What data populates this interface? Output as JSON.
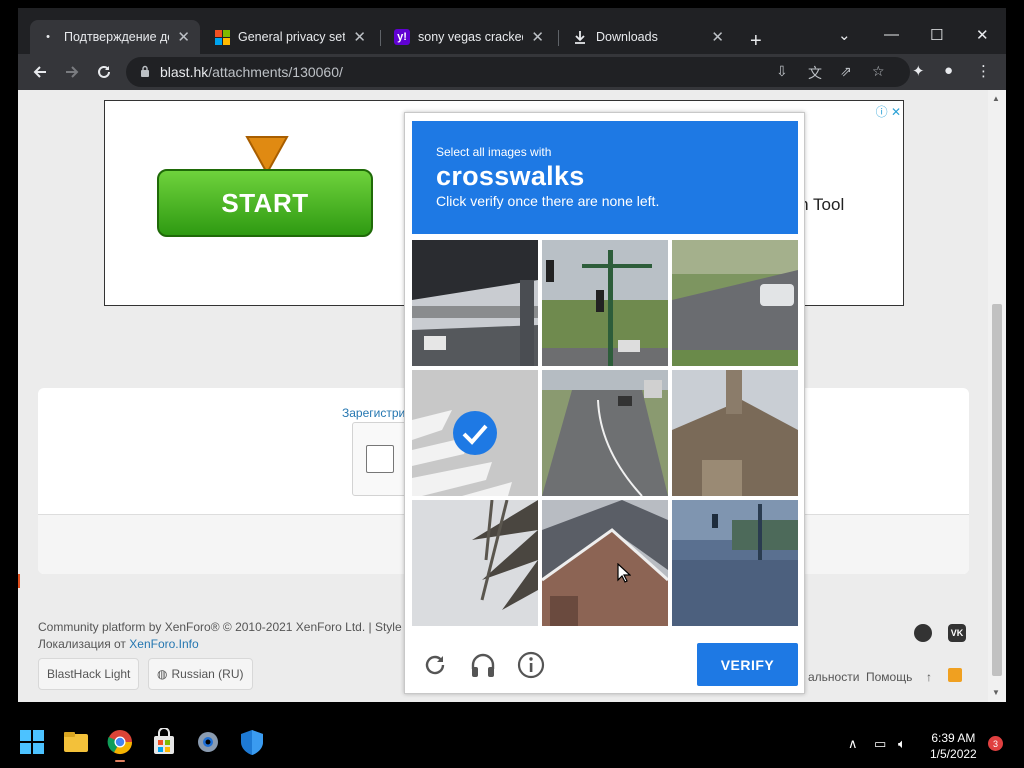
{
  "browser": {
    "tabs": [
      {
        "title": "Подтверждение дей",
        "favicon": "dot-icon"
      },
      {
        "title": "General privacy settin",
        "favicon": "microsoft-logo-icon"
      },
      {
        "title": "sony vegas cracked -",
        "favicon": "yahoo-icon"
      },
      {
        "title": "Downloads",
        "favicon": "download-icon"
      }
    ],
    "tab_close": "✕",
    "new_tab": "+",
    "url_host": "blast.hk",
    "url_path": "/attachments/130060/",
    "window_controls": {
      "minimize": "—",
      "maximize": "☐",
      "close": "✕",
      "dropdown": "⌄"
    }
  },
  "page": {
    "ad": {
      "button": "START",
      "text_fragment": "rch Tool",
      "badge": "ⓘ ✕"
    },
    "register_link": "Зарегистри",
    "footer_line1": "Community platform by XenForo® © 2010-2021 XenForo Ltd. | Style a",
    "footer_line2_prefix": "Локализация от ",
    "footer_line2_link": "XenForo.Info",
    "style_chooser": "BlastHack Light",
    "language_chooser": "Russian (RU)",
    "footer_links": [
      "альности",
      "Помощь",
      "↑"
    ],
    "vk": "VK"
  },
  "captcha": {
    "instruction_small": "Select all images with",
    "instruction_target": "crosswalks",
    "instruction_sub": "Click verify once there are none left.",
    "verify_label": "VERIFY",
    "tiles": [
      {
        "index": 1,
        "scene": "highway-overpass",
        "selected": false
      },
      {
        "index": 2,
        "scene": "traffic-light-street",
        "selected": false
      },
      {
        "index": 3,
        "scene": "suburban-road-car",
        "selected": false
      },
      {
        "index": 4,
        "scene": "crosswalk",
        "selected": true
      },
      {
        "index": 5,
        "scene": "road-cars",
        "selected": false
      },
      {
        "index": 6,
        "scene": "house-roof",
        "selected": false
      },
      {
        "index": 7,
        "scene": "palm-tree",
        "selected": false
      },
      {
        "index": 8,
        "scene": "brick-house",
        "selected": false
      },
      {
        "index": 9,
        "scene": "traffic-light-blue",
        "selected": false
      }
    ]
  },
  "taskbar": {
    "time": "6:39 AM",
    "date": "1/5/2022",
    "notifications": "3",
    "tray_chevron": "∧"
  },
  "colors": {
    "accent": "#1e79e4",
    "start_green": "#3cae1a",
    "chrome_dark": "#202124"
  }
}
